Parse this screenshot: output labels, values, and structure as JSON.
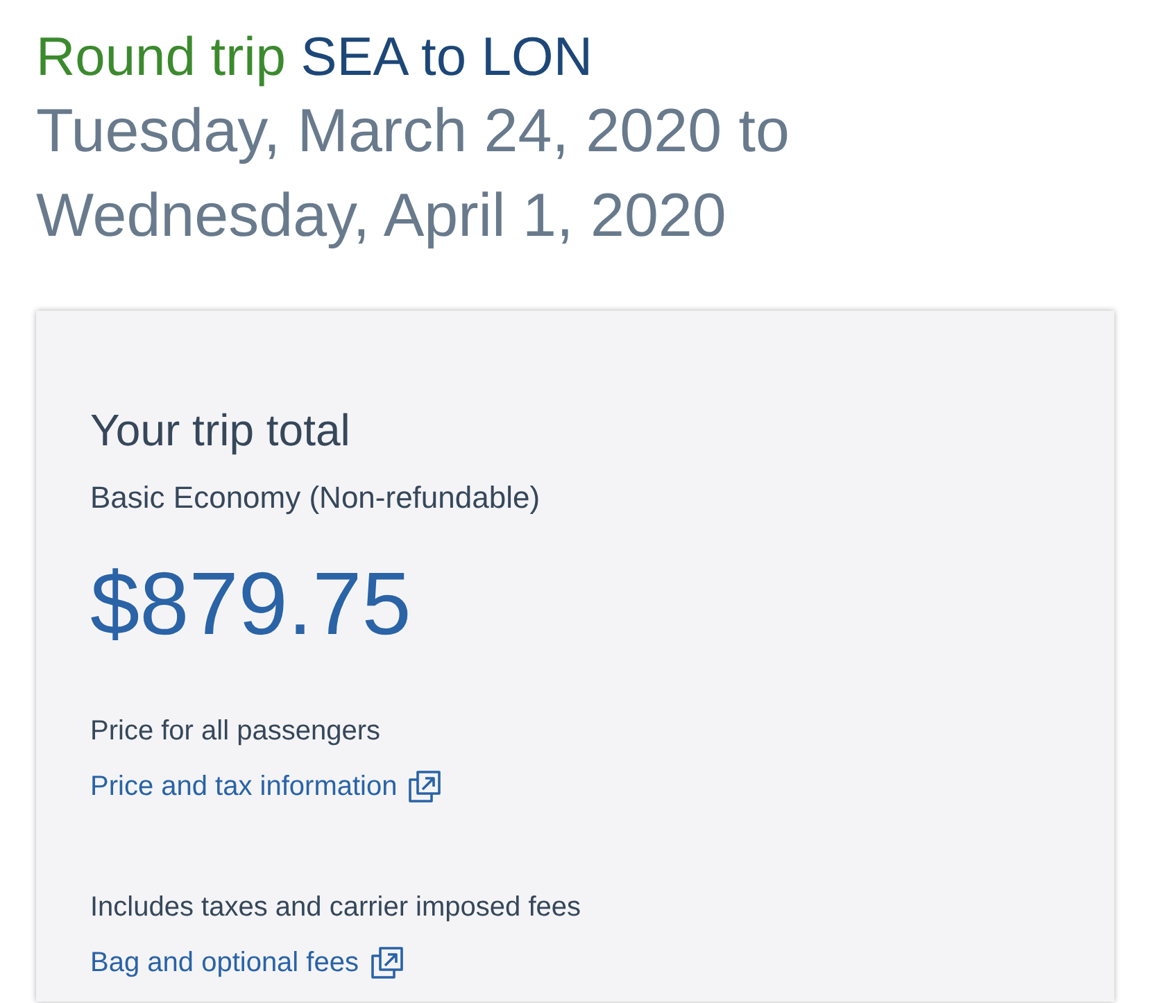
{
  "header": {
    "trip_type": "Round trip",
    "route": "SEA to LON",
    "dates": "Tuesday, March 24, 2020 to Wednesday, April 1, 2020"
  },
  "summary": {
    "title": "Your trip total",
    "fare_type": "Basic Economy (Non-refundable)",
    "total": "$879.75",
    "notes": [
      {
        "text": "Price for all passengers",
        "link": "Price and tax information"
      },
      {
        "text": "Includes taxes and carrier imposed fees",
        "link": "Bag and optional fees"
      }
    ]
  }
}
